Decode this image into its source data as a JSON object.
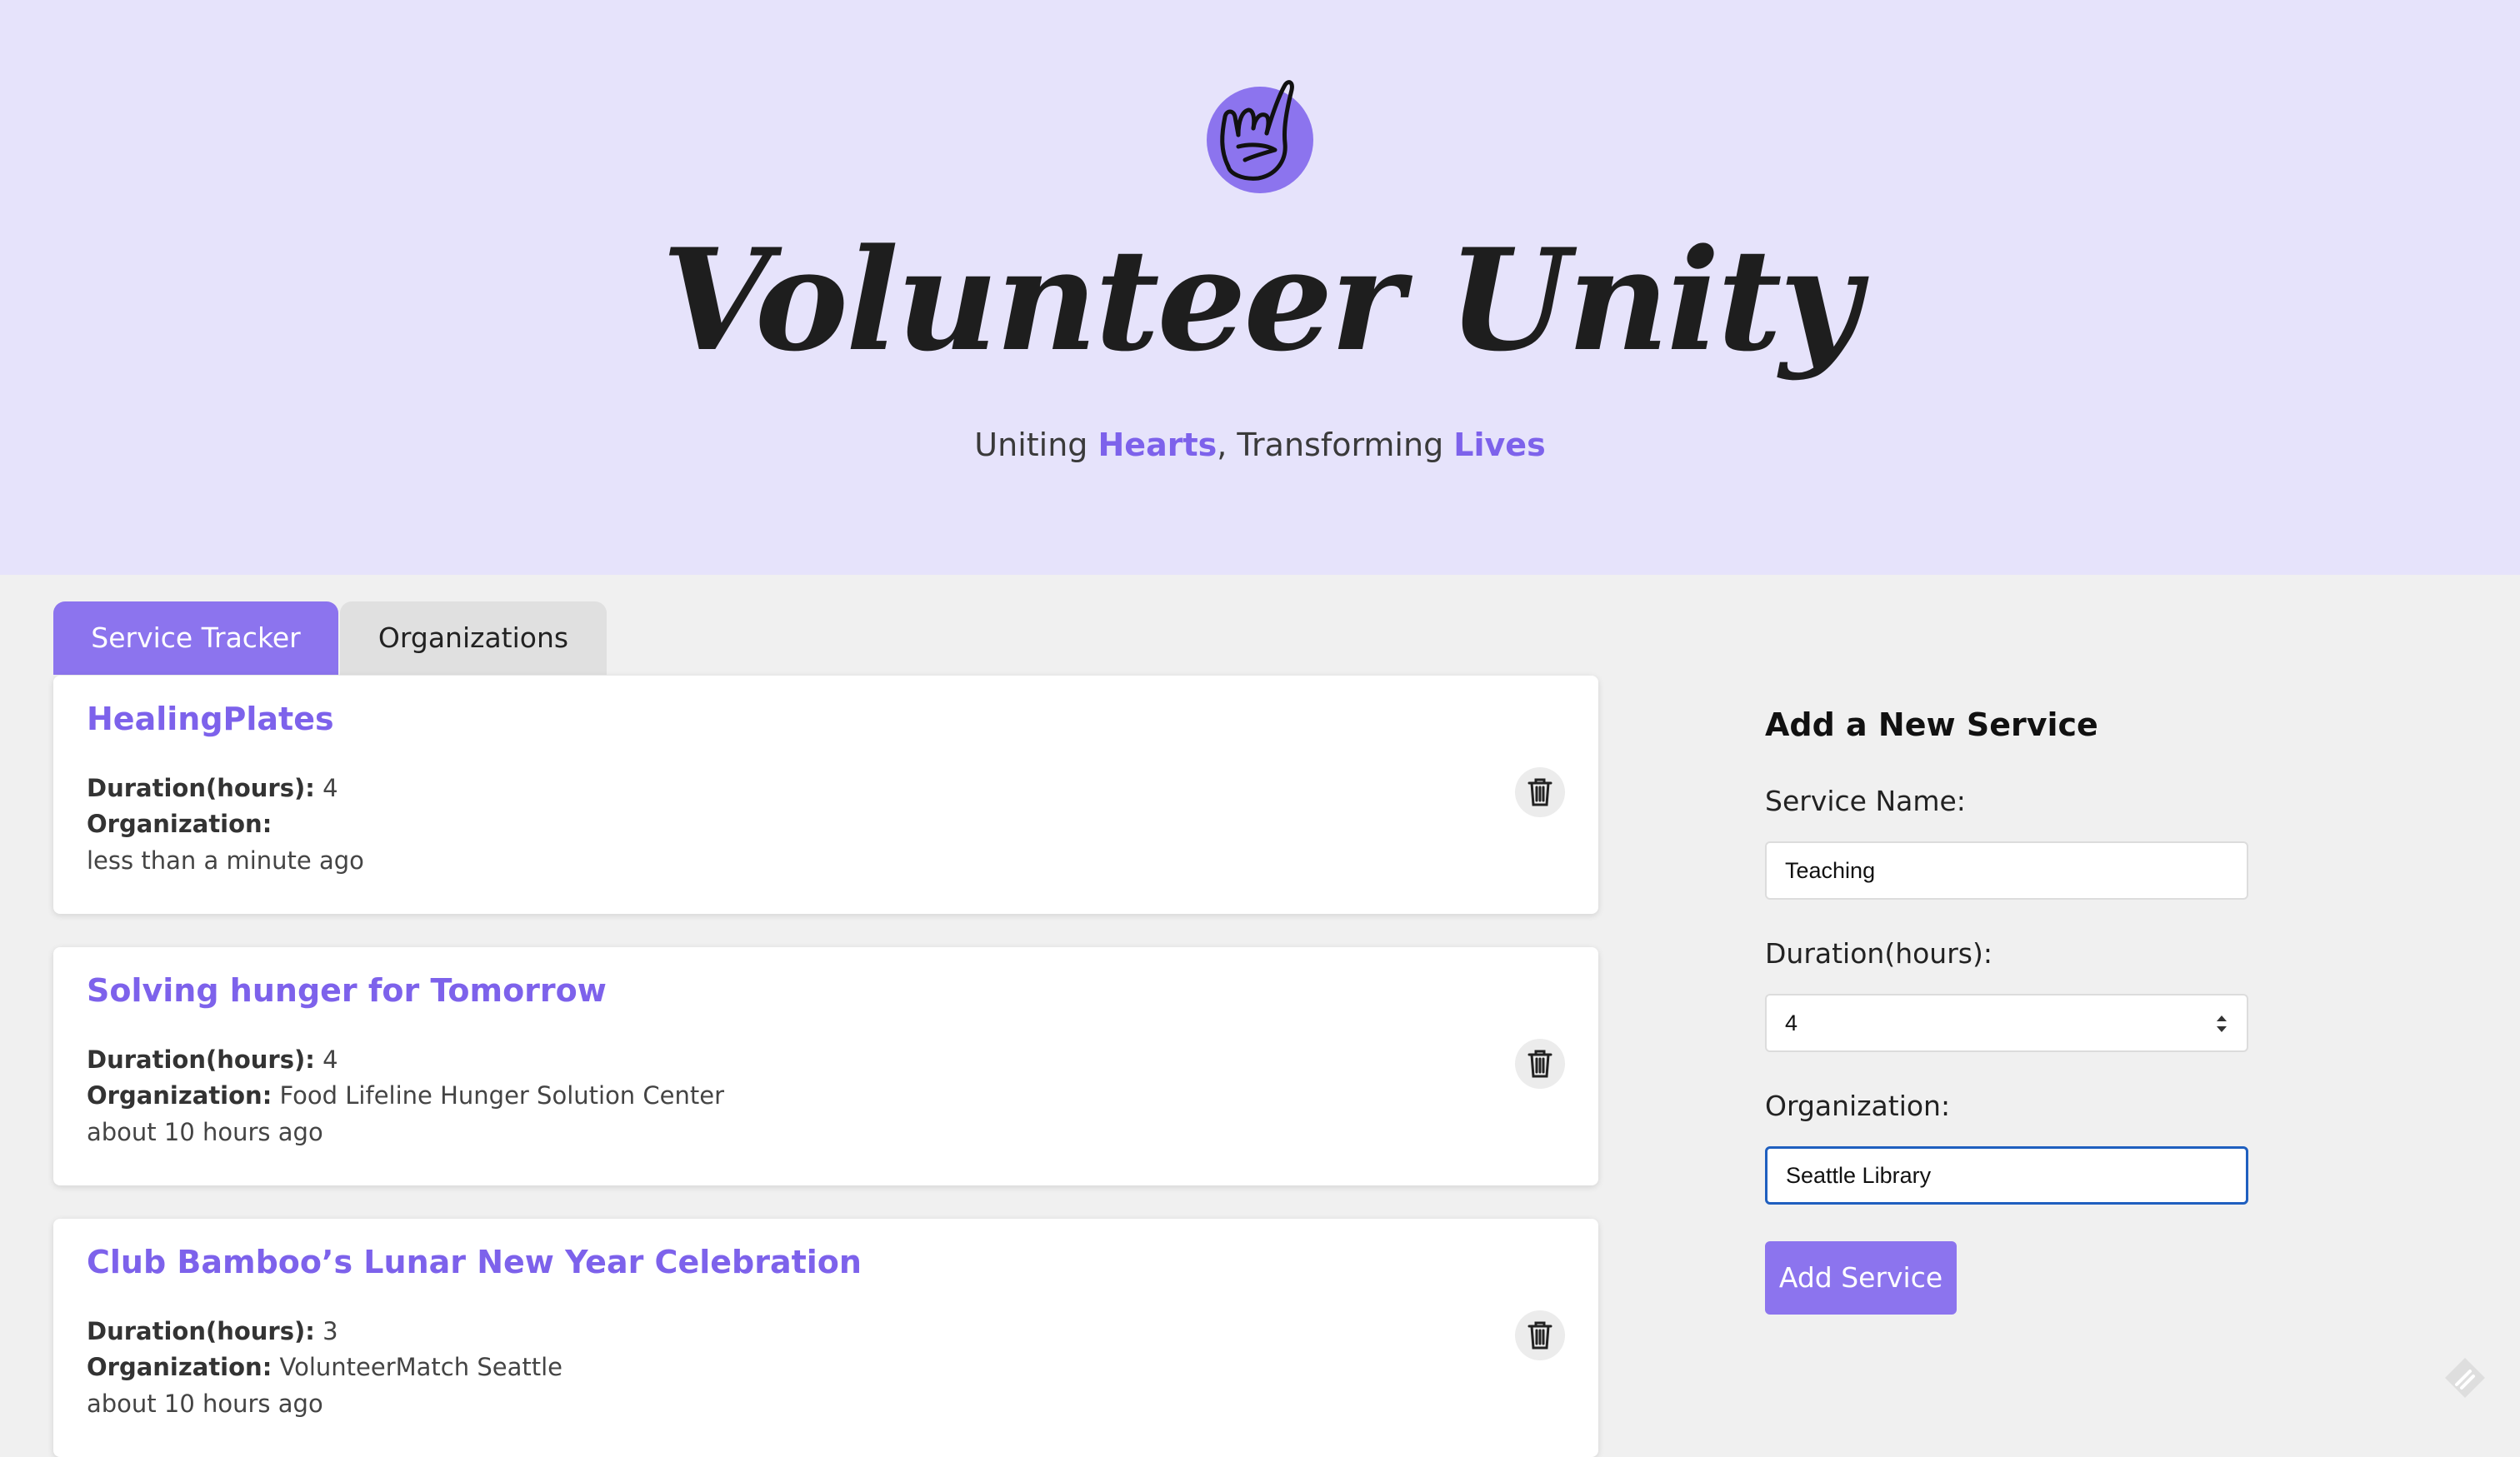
{
  "header": {
    "logo_icon": "rock-hand-icon",
    "title": "Volunteer Unity",
    "tagline": {
      "part1": "Uniting ",
      "hl1": "Hearts",
      "part2": ", Transforming ",
      "hl2": "Lives"
    }
  },
  "tabs": [
    {
      "label": "Service Tracker",
      "active": true
    },
    {
      "label": "Organizations",
      "active": false
    }
  ],
  "labels": {
    "duration": "Duration(hours):",
    "organization": "Organization:"
  },
  "services": [
    {
      "name": "HealingPlates",
      "duration": "4",
      "organization": "",
      "time": "less than a minute ago"
    },
    {
      "name": "Solving hunger for Tomorrow",
      "duration": "4",
      "organization": "Food Lifeline Hunger Solution Center",
      "time": "about 10 hours ago"
    },
    {
      "name": "Club Bamboo’s Lunar New Year Celebration",
      "duration": "3",
      "organization": "VolunteerMatch Seattle",
      "time": "about 10 hours ago"
    }
  ],
  "form": {
    "title": "Add a New Service",
    "service_name_label": "Service Name:",
    "service_name_value": "Teaching",
    "duration_label": "Duration(hours):",
    "duration_value": "4",
    "organization_label": "Organization:",
    "organization_value": "Seattle Library",
    "submit_label": "Add Service"
  },
  "colors": {
    "accent": "#8c74ee",
    "hero_bg": "#e6e3fb",
    "page_bg": "#f0f0f0"
  }
}
